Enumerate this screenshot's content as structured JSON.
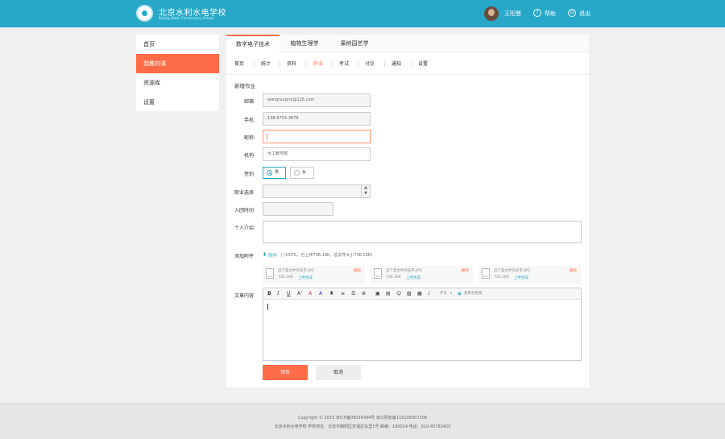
{
  "header": {
    "school_name": "北京水利水电学校",
    "school_name_en": "Beijing Water Conservancy School",
    "user_name": "王阳慧",
    "help_label": "帮助",
    "logout_label": "退出",
    "brand_color": "#27a8c9"
  },
  "sidebar": {
    "items": [
      {
        "label": "首页"
      },
      {
        "label": "我教的课"
      },
      {
        "label": "资源库"
      },
      {
        "label": "设置"
      }
    ],
    "active_index": 1,
    "accent_color": "#ff6c47"
  },
  "tabs": [
    {
      "label": "数字电子技术"
    },
    {
      "label": "植物生理学"
    },
    {
      "label": "果树园艺学"
    }
  ],
  "subnav": [
    {
      "label": "首页"
    },
    {
      "label": "统计"
    },
    {
      "label": "资料"
    },
    {
      "label": "作业"
    },
    {
      "label": "考试"
    },
    {
      "label": "讨论"
    },
    {
      "label": "通知"
    },
    {
      "label": "设置"
    }
  ],
  "form": {
    "section_title": "新增作业",
    "email": {
      "label": "邮箱",
      "value": "wangraugrui@126.com"
    },
    "phone": {
      "label": "手机",
      "value": "138-6754-3678"
    },
    "nickname": {
      "label": "昵称:",
      "value": ""
    },
    "org": {
      "label": "机构",
      "value": "水工教学部"
    },
    "gender": {
      "label": "性别",
      "options": [
        "男",
        "女"
      ],
      "selected": "男"
    },
    "job": {
      "label": "职业选择",
      "value": ""
    },
    "join_date": {
      "label": "入团时间",
      "value": ""
    },
    "intro": {
      "label": "个人介绍",
      "value": ""
    },
    "attachment": {
      "label": "添加附件",
      "link": "附件",
      "info": "(100%，已上传736.16K，总文件大小736.16K)",
      "files": [
        {
          "name": "这个是文件的名字.JPG",
          "size": "736.16K",
          "status": "上传完成",
          "delete": "删除",
          "type": "JPG"
        },
        {
          "name": "这个是文件的名字.JPG",
          "size": "736.16K",
          "status": "上传完成",
          "delete": "删除",
          "type": "JPG"
        },
        {
          "name": "这个是文件的名字.JPG",
          "size": "736.16K",
          "status": "上传完成",
          "delete": "删除",
          "type": "JPG"
        }
      ]
    },
    "content": {
      "label": "文章内容",
      "toolbar": {
        "font_size": "字号",
        "paste_label": "复制合板图"
      }
    },
    "save_label": "保存",
    "cancel_label": "取消"
  },
  "footer": {
    "line1": "Copyright © 2015  京ICP备09034394号   京公网安备110105007208",
    "line2": "北京水利水电学校    学校地址：北京市朝阳区安福庄东里1号     邮编：100024     电话：010-65782420"
  }
}
